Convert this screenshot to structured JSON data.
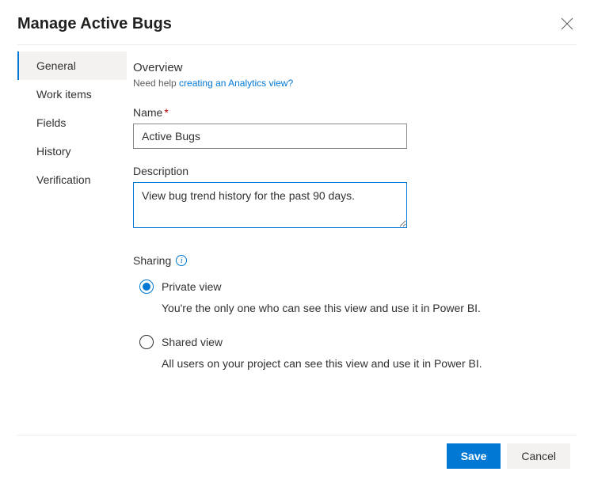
{
  "header": {
    "title": "Manage Active Bugs"
  },
  "sidebar": {
    "items": [
      {
        "label": "General",
        "selected": true
      },
      {
        "label": "Work items",
        "selected": false
      },
      {
        "label": "Fields",
        "selected": false
      },
      {
        "label": "History",
        "selected": false
      },
      {
        "label": "Verification",
        "selected": false
      }
    ]
  },
  "main": {
    "overview_title": "Overview",
    "help_prefix": "Need help ",
    "help_link_text": "creating an Analytics view?",
    "name_label": "Name",
    "name_value": "Active Bugs",
    "description_label": "Description",
    "description_value": "View bug trend history for the past 90 days.",
    "sharing_label": "Sharing",
    "sharing_options": [
      {
        "label": "Private view",
        "description": "You're the only one who can see this view and use it in Power BI.",
        "selected": true
      },
      {
        "label": "Shared view",
        "description": "All users on your project can see this view and use it in Power BI.",
        "selected": false
      }
    ]
  },
  "footer": {
    "save_label": "Save",
    "cancel_label": "Cancel"
  }
}
